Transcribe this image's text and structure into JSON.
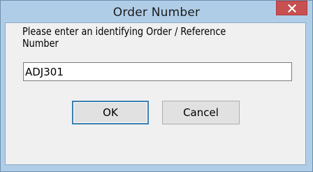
{
  "window": {
    "title": "Order Number"
  },
  "dialog": {
    "prompt": "Please enter an identifying Order / Reference Number",
    "input_value": "ADJ301",
    "ok_label": "OK",
    "cancel_label": "Cancel"
  },
  "icons": {
    "close": "close-icon"
  },
  "colors": {
    "titlebar": "#b0cde8",
    "close_button": "#c75050",
    "dialog_background": "#f0f0f0",
    "default_button_border": "#3c7fb1"
  }
}
